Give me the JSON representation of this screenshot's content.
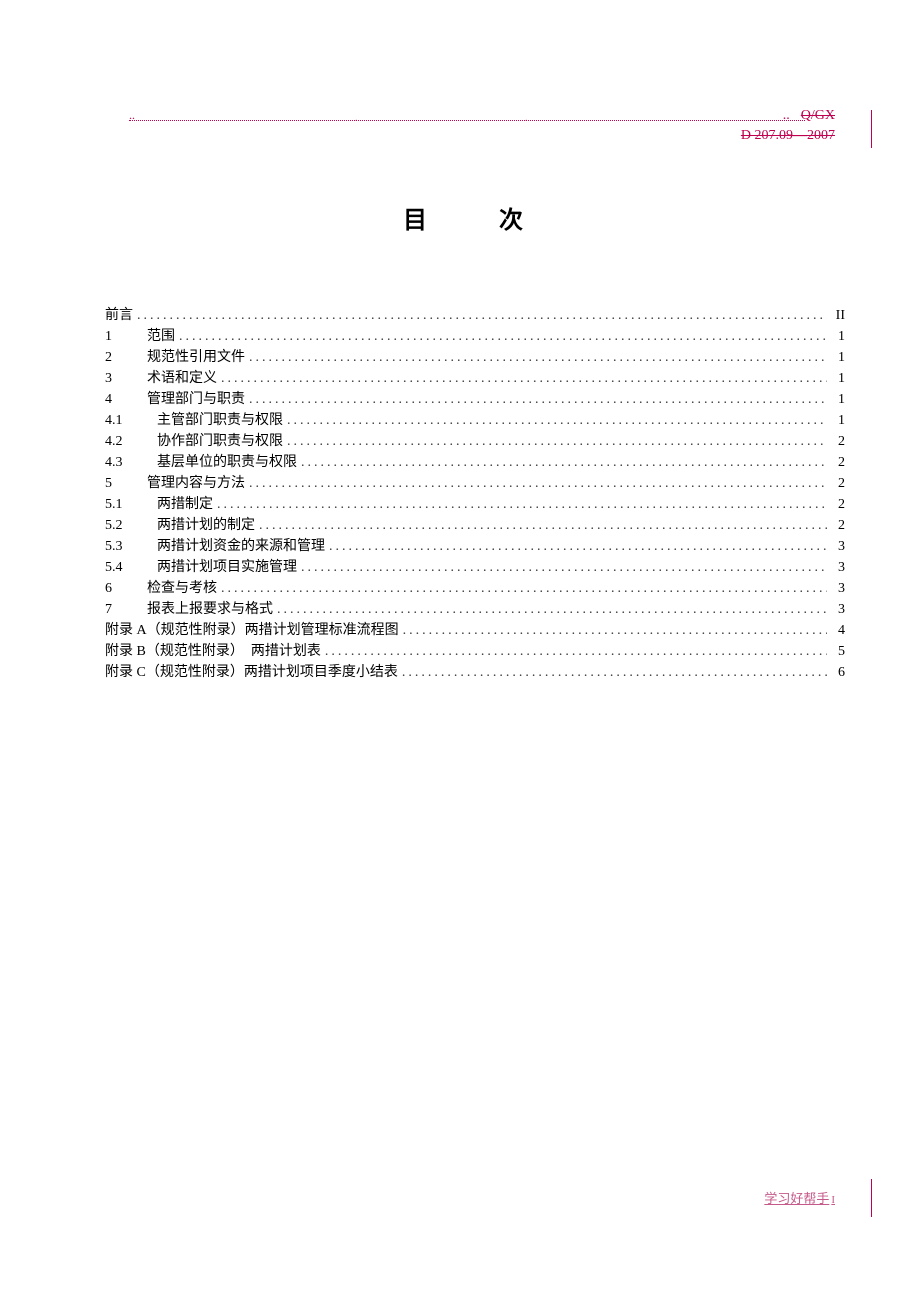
{
  "header": {
    "code_line1": "Q/GX",
    "code_line2": "D 207.09—2007"
  },
  "title": "目　次",
  "toc": [
    {
      "num": "",
      "text": "前言",
      "page": "II",
      "indent": "none"
    },
    {
      "num": "1",
      "text": "范围",
      "page": "1",
      "indent": "num"
    },
    {
      "num": "2",
      "text": "规范性引用文件",
      "page": "1",
      "indent": "num"
    },
    {
      "num": "3",
      "text": "术语和定义",
      "page": "1",
      "indent": "num"
    },
    {
      "num": "4",
      "text": "管理部门与职责",
      "page": "1",
      "indent": "num"
    },
    {
      "num": "4.1",
      "text": "主管部门职责与权限",
      "page": "1",
      "indent": "wide"
    },
    {
      "num": "4.2",
      "text": "协作部门职责与权限",
      "page": "2",
      "indent": "wide"
    },
    {
      "num": "4.3",
      "text": "基层单位的职责与权限",
      "page": "2",
      "indent": "wide"
    },
    {
      "num": "5",
      "text": "管理内容与方法",
      "page": "2",
      "indent": "num"
    },
    {
      "num": "5.1",
      "text": "两措制定",
      "page": "2",
      "indent": "wide"
    },
    {
      "num": "5.2",
      "text": "两措计划的制定",
      "page": "2",
      "indent": "wide"
    },
    {
      "num": "5.3",
      "text": "两措计划资金的来源和管理",
      "page": "3",
      "indent": "wide"
    },
    {
      "num": "5.4",
      "text": "两措计划项目实施管理",
      "page": "3",
      "indent": "wide"
    },
    {
      "num": "6",
      "text": "检查与考核",
      "page": "3",
      "indent": "num"
    },
    {
      "num": "7",
      "text": "报表上报要求与格式",
      "page": "3",
      "indent": "num"
    },
    {
      "num": "",
      "text": "附录 A（规范性附录）两措计划管理标准流程图",
      "page": "4",
      "indent": "none"
    },
    {
      "num": "",
      "text": "附录 B（规范性附录）　两措计划表",
      "page": "5",
      "indent": "none"
    },
    {
      "num": "",
      "text": "附录 C（规范性附录）两措计划项目季度小结表",
      "page": "6",
      "indent": "none"
    }
  ],
  "footer": {
    "text": "学习好帮手",
    "mark": "I"
  }
}
